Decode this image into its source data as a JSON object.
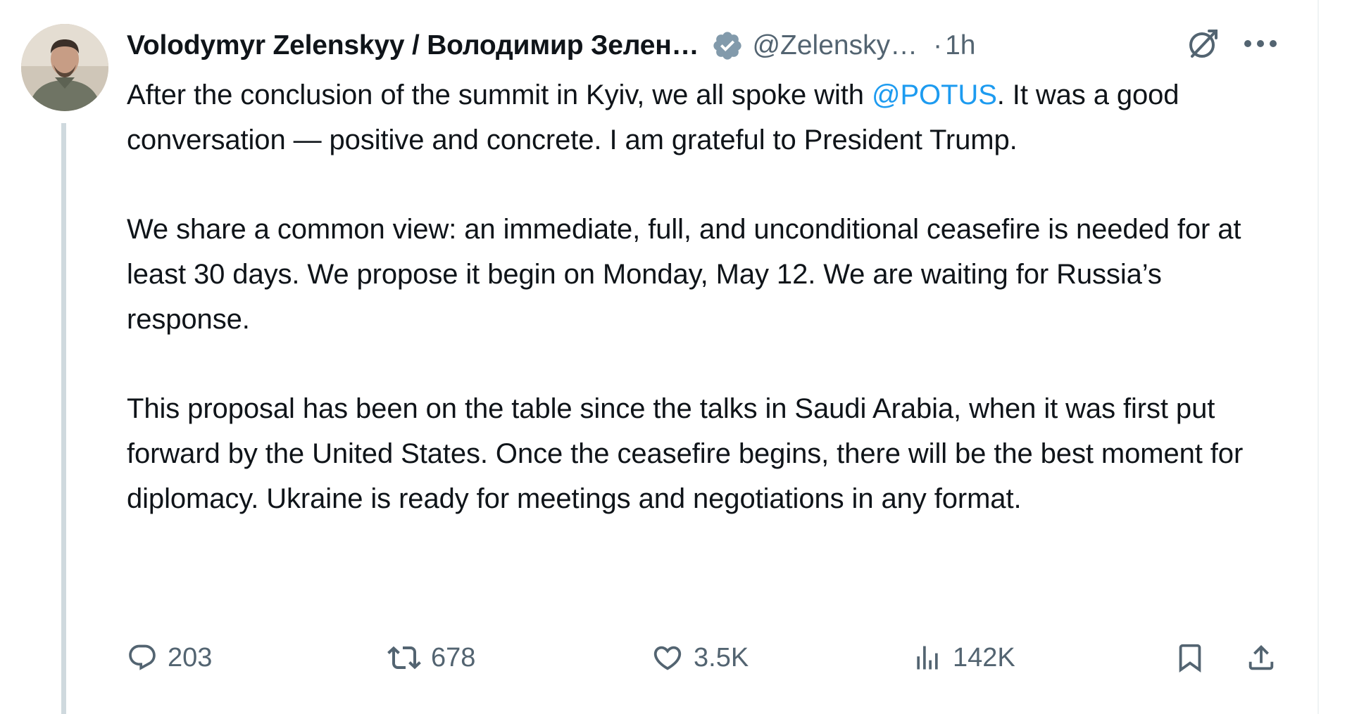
{
  "author": {
    "display_name": "Volodymyr Zelenskyy / Володимир Зелен…",
    "handle": "@Zelensky…",
    "separator": "·",
    "time": "1h",
    "verified_color": "#829aab"
  },
  "tweet": {
    "p1_before": "After the conclusion of the summit in Kyiv, we all spoke with ",
    "p1_mention": "@POTUS",
    "p1_after": ". It was a good conversation — positive and concrete. I am grateful to President Trump.",
    "p2": "We share a common view: an immediate, full, and unconditional ceasefire is needed for at least 30 days. We propose it begin on Monday, May 12. We are waiting for Russia’s response.",
    "p3": "This proposal has been on the table since the talks in Saudi Arabia, when it was first put forward by the United States. Once the ceasefire begins, there will be the best moment for diplomacy. Ukraine is ready for meetings and negotiations in any format."
  },
  "actions": {
    "replies": "203",
    "reposts": "678",
    "likes": "3.5K",
    "views": "142K"
  },
  "icons": {
    "reply": "reply-icon",
    "repost": "repost-icon",
    "like": "heart-icon",
    "views": "views-icon",
    "bookmark": "bookmark-icon",
    "share": "share-icon",
    "grok": "grok-icon",
    "more": "more-icon",
    "verified": "verified-badge-icon"
  },
  "colors": {
    "text": "#0f1419",
    "secondary": "#536471",
    "link": "#1d9bf0"
  }
}
